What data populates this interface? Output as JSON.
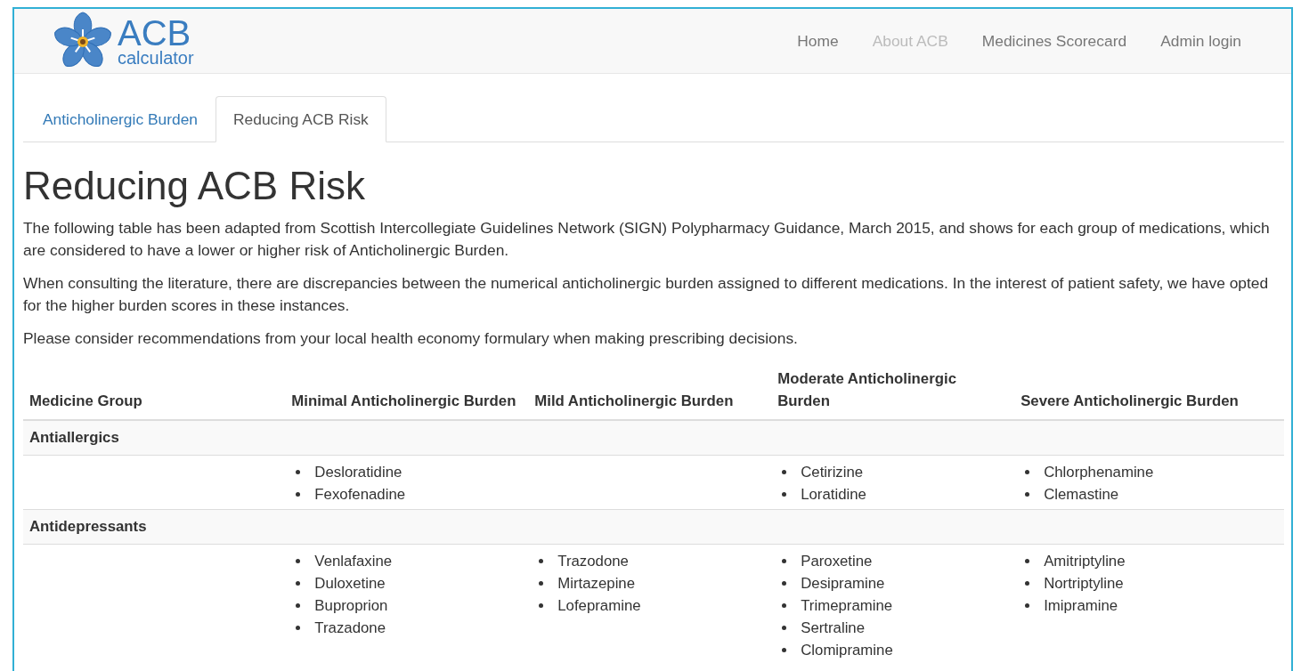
{
  "logo": {
    "title": "ACB",
    "subtitle": "calculator"
  },
  "nav": [
    {
      "label": "Home",
      "selected": false
    },
    {
      "label": "About ACB",
      "selected": true
    },
    {
      "label": "Medicines Scorecard",
      "selected": false
    },
    {
      "label": "Admin login",
      "selected": false
    }
  ],
  "tabs": [
    {
      "label": "Anticholinergic Burden",
      "selected": false
    },
    {
      "label": "Reducing ACB Risk",
      "selected": true
    }
  ],
  "heading": "Reducing ACB Risk",
  "paragraphs": [
    "The following table has been adapted from Scottish Intercollegiate Guidelines Network (SIGN) Polypharmacy Guidance, March 2015, and shows for each group of medications, which are considered to have a lower or higher risk of Anticholinergic Burden.",
    "When consulting the literature, there are discrepancies between the numerical anticholinergic burden assigned to different medications. In the interest of patient safety, we have opted for the higher burden scores in these instances.",
    "Please consider recommendations from your local health economy formulary when making prescribing decisions."
  ],
  "table": {
    "columns": [
      "Medicine Group",
      "Minimal Anticholinergic Burden",
      "Mild Anticholinergic Burden",
      "Moderate Anticholinergic Burden",
      "Severe Anticholinergic Burden"
    ],
    "groups": [
      {
        "name": "Antiallergics",
        "minimal": [
          "Desloratidine",
          "Fexofenadine"
        ],
        "moderate": [
          "Cetirizine",
          "Loratidine"
        ],
        "severe": [
          "Chlorphenamine",
          "Clemastine"
        ]
      },
      {
        "name": "Antidepressants",
        "minimal": [
          "Venlafaxine",
          "Duloxetine",
          "Buproprion",
          "Trazadone"
        ],
        "mild": [
          "Trazodone",
          "Mirtazepine",
          "Lofepramine"
        ],
        "moderate": [
          "Paroxetine",
          "Desipramine",
          "Trimepramine",
          "Sertraline",
          "Clomipramine"
        ],
        "severe": [
          "Amitriptyline",
          "Nortriptyline",
          "Imipramine"
        ]
      }
    ]
  }
}
